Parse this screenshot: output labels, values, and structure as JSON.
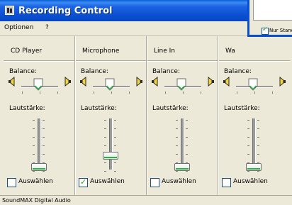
{
  "window": {
    "title": "Recording Control"
  },
  "menu": {
    "items": [
      "Optionen",
      "?"
    ]
  },
  "labels": {
    "balance": "Balance:",
    "volume": "Lautstärke:",
    "select": "Auswählen"
  },
  "channels": [
    {
      "name": "CD Player",
      "balance": 0.0,
      "volume": 0.0,
      "selected": false
    },
    {
      "name": "Microphone",
      "balance": 0.0,
      "volume": 0.25,
      "selected": true
    },
    {
      "name": "Line In",
      "balance": 0.0,
      "volume": 0.0,
      "selected": false
    },
    {
      "name": "Wa",
      "balance": 0.0,
      "volume": 0.0,
      "selected": false
    }
  ],
  "overlay": {
    "checkbox_label": "Nur Standa",
    "checked": true
  },
  "status": {
    "text": "SoundMAX Digital Audio"
  },
  "colors": {
    "titlebar": "#0a4ed0",
    "thumb_accent": "#24b24a",
    "check": "#21a121"
  }
}
